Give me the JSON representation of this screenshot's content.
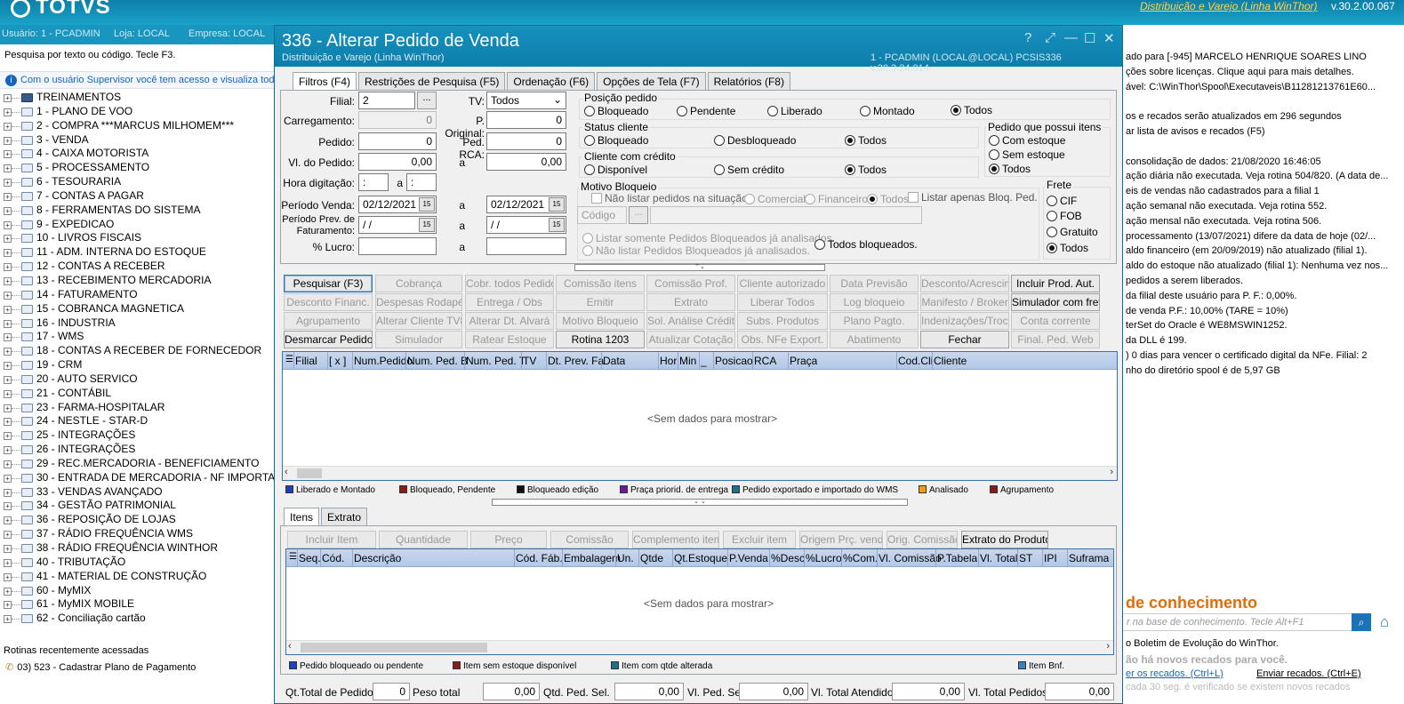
{
  "banner": {
    "logo": "TOTVS",
    "brand_link": "Distribuição e Varejo (Linha WinThor)",
    "version": "v.30.2.00.067"
  },
  "leftbar": {
    "user": "Usuário: 1 - PCADMIN",
    "store": "Loja: LOCAL",
    "company": "Empresa: LOCAL"
  },
  "search_hint": "Pesquisa por texto ou código. Tecle F3.",
  "notice": "Com o usuário Supervisor você tem acesso e visualiza toda",
  "tree": [
    "TREINAMENTOS",
    "1 - PLANO DE VOO",
    "2 - COMPRA          ***MARCUS MILHOMEM***",
    "3 - VENDA",
    "4 - CAIXA MOTORISTA",
    "5 - PROCESSAMENTO",
    "6 - TESOURARIA",
    "7 - CONTAS A PAGAR",
    "8 - FERRAMENTAS DO SISTEMA",
    "9 - EXPEDICAO",
    "10 - LIVROS FISCAIS",
    "11 - ADM. INTERNA DO ESTOQUE",
    "12 - CONTAS A RECEBER",
    "13 - RECEBIMENTO MERCADORIA",
    "14 - FATURAMENTO",
    "15 - COBRANCA MAGNETICA",
    "16 - INDUSTRIA",
    "17 - WMS",
    "18 - CONTAS A RECEBER DE FORNECEDOR",
    "19 - CRM",
    "20 - AUTO SERVICO",
    "21 - CONTÁBIL",
    "23 - FARMA-HOSPITALAR",
    "24 - NESTLE - STAR-D",
    "25 - INTEGRAÇÕES",
    "26 - INTEGRAÇÕES",
    "29 - REC.MERCADORIA - BENEFICIAMENTO",
    "30 - ENTRADA DE MERCADORIA - NF IMPORTAÇÃ",
    "33 - VENDAS AVANÇADO",
    "34 - GESTÃO PATRIMONIAL",
    "36 - REPOSIÇÃO DE LOJAS",
    "37 - RÁDIO FREQUÊNCIA WMS",
    "38 - RÁDIO FREQUÊNCIA WINTHOR",
    "40 - TRIBUTAÇÃO",
    "41 - MATERIAL DE CONSTRUÇÃO",
    "60 - MyMIX",
    "61 - MyMIX MOBILE",
    "62 - Conciliação cartão"
  ],
  "recent": {
    "title": "Rotinas recentemente acessadas",
    "item": "03)  523 - Cadastrar Plano de Pagamento"
  },
  "right_info": [
    "ado para [-945] MARCELO HENRIQUE SOARES LINO",
    "ções sobre licenças. Clique aqui para mais detalhes.",
    "ável: C:\\WinThor\\Spool\\Executaveis\\B11281213761E60...",
    "",
    "os e recados serão atualizados em 296 segundos",
    "ar lista de avisos e recados (F5)",
    "",
    "consolidação de dados: 21/08/2020 16:46:05",
    "ação diária não executada. Veja rotina 504/820. (A data de...",
    "eis de vendas não cadastrados para a filial 1",
    "ação semanal não executada. Veja rotina 552.",
    "ação mensal não executada. Veja rotina 506.",
    "processamento (13/07/2021) difere da data de hoje (02/...",
    "aldo financeiro (em 20/09/2019) não atualizado (filial 1).",
    "aldo do estoque não atualizado (filial 1): Nenhuma vez nos...",
    "pedidos a serem liberados.",
    "da filial deste usuário para P. F.: 0,00%.",
    "de venda P.F.: 10,00% (TARE = 10%)",
    "terSet do Oracle é WE8MSWIN1252.",
    "da DLL é 199.",
    ") 0 dias para vencer o certificado digital da NFe. Filial: 2",
    "nho do diretório spool é de 5,97 GB"
  ],
  "kb": {
    "title": "de conhecimento",
    "search_placeholder": "r na base de conhecimento. Tecle Alt+F1",
    "line1": "o Boletim de Evolução do WinThor.",
    "line2": "ão há novos recados para você.",
    "link1": "er os recados. (Ctrl+L)",
    "link2": "Enviar recados. (Ctrl+E)",
    "line3": "cada 30 seg. é verificado se existem novos recados"
  },
  "dialog": {
    "title": "336 - Alterar Pedido de Venda",
    "subtitle": "Distribuição e Varejo (Linha WinThor)",
    "user_info": "1 - PCADMIN (LOCAL@LOCAL)   PCSIS336  v.30.3.24.014",
    "controls": {
      "help": "?",
      "restore": "⤢",
      "minimize": "—",
      "maximize": "☐",
      "close": "✕"
    },
    "tabs": [
      "Filtros (F4)",
      "Restrições de Pesquisa (F5)",
      "Ordenação (F6)",
      "Opções de Tela (F7)",
      "Relatórios (F8)"
    ],
    "filters": {
      "filial_label": "Filial:",
      "filial_value": "2",
      "lookup": "...",
      "tv_label": "TV:",
      "tv_value": "Todos",
      "carregamento_label": "Carregamento:",
      "carregamento_value": "0",
      "p_original_label": "P. Original:",
      "p_original_value": "0",
      "pedido_label": "Pedido:",
      "pedido_value": "0",
      "ped_rca_label": "Ped. RCA:",
      "ped_rca_value": "0",
      "vl_pedido_label": "Vl. do Pedido:",
      "vl_pedido_from": "0,00",
      "a": "a",
      "vl_pedido_to": "0,00",
      "hora_label": "Hora digitação:",
      "hora_from": ":",
      "hora_to": ":",
      "periodo_label": "Período Venda:",
      "periodo_from": "02/12/2021",
      "periodo_to": "02/12/2021",
      "prev_fat_label1": "Período Prev. de",
      "prev_fat_label2": "Faturamento:",
      "prev_fat_from": " / /",
      "prev_fat_to": " / /",
      "lucro_label": "% Lucro:",
      "calendar": "15"
    },
    "posicao": {
      "title": "Posição pedido",
      "opts": [
        "Bloqueado",
        "Pendente",
        "Liberado",
        "Montado",
        "Todos"
      ]
    },
    "status": {
      "title": "Status cliente",
      "opts": [
        "Bloqueado",
        "Desbloqueado",
        "Todos"
      ]
    },
    "credito": {
      "title": "Cliente com crédito",
      "opts": [
        "Disponível",
        "Sem crédito",
        "Todos"
      ]
    },
    "itens": {
      "title": "Pedido que possui itens",
      "opts": [
        "Com estoque",
        "Sem estoque",
        "Todos"
      ]
    },
    "frete": {
      "title": "Frete",
      "opts": [
        "CIF",
        "FOB",
        "Gratuito",
        "Todos"
      ]
    },
    "motivo": {
      "title": "Motivo Bloqueio",
      "nao_listar": "Não listar pedidos na situação:",
      "opts": [
        "Comercial",
        "Financeiro",
        "Todos"
      ],
      "listar_apenas": "Listar apenas Bloq. Ped.",
      "codigo": "Código",
      "lookup": "...",
      "listar_somente": "Listar somente Pedidos Bloqueados já analisados.",
      "nao_listar_bloq": "Não listar Pedidos Bloqueados já analisados.",
      "todos_bloqueados": "Todos bloqueados."
    },
    "actions": [
      [
        "Pesquisar (F3)",
        "Cobrança",
        "Cobr. todos Pedidos",
        "Comissão itens",
        "Comissão Prof.",
        "Cliente autorizado",
        "Data Previsão",
        "Desconto/Acrescimo",
        "Incluir Prod. Aut."
      ],
      [
        "Desconto Financ.",
        "Despesas Rodapé",
        "Entrega / Obs",
        "Emitir",
        "Extrato",
        "Liberar Todos",
        "Log bloqueio",
        "Manifesto / Broker",
        "Simulador com frete"
      ],
      [
        "Agrupamento",
        "Alterar Cliente TV8",
        "Alterar Dt. Alvará",
        "Motivo Bloqueio",
        "Sol. Análise Crédito",
        "Subs. Produtos",
        "Plano Pagto.",
        "Indenizações/Troca",
        "Conta corrente"
      ],
      [
        "Desmarcar Pedidos",
        "Simulador",
        "Ratear Estoque",
        "Rotina 1203",
        "Atualizar Cotação",
        "Obs. NFe Export.",
        "Abatimento",
        "Fechar",
        "Final. Ped. Web"
      ]
    ],
    "grid1": {
      "columns": [
        "Filial",
        "[ x ]",
        "Num.Pedido",
        "Num. Ped. B",
        "Num. Ped. T",
        "TV",
        "Dt. Prev. Fa",
        "Data",
        "Hor",
        "Min",
        "_",
        "Posicao",
        "RCA",
        "Praça",
        "Cod.Cli",
        "Cliente"
      ],
      "empty": "<Sem dados para mostrar>"
    },
    "legend1": [
      {
        "label": "Liberado e Montado",
        "color": "#1f3fbf"
      },
      {
        "label": "Bloqueado, Pendente",
        "color": "#8b1a1a"
      },
      {
        "label": "Bloqueado edição",
        "color": "#111111"
      },
      {
        "label": "Praça priorid. de entrega",
        "color": "#6a1b9a"
      },
      {
        "label": "Pedido exportado e importado do WMS",
        "color": "#1d6f8a"
      },
      {
        "label": "Analisado",
        "color": "#f39c12"
      },
      {
        "label": "Agrupamento",
        "color": "#8b1a1a"
      }
    ],
    "tabs2": [
      "Itens",
      "Extrato"
    ],
    "item_actions": [
      "Incluir Item",
      "Quantidade",
      "Preço",
      "Comissão",
      "Complemento item",
      "Excluir item",
      "Origem Prç. venda",
      "Orig. Comissão",
      "Extrato do Produto"
    ],
    "grid2": {
      "columns": [
        "Seq.",
        "Cód.",
        "Descrição",
        "Cód. Fáb.",
        "Embalagem",
        "Un.",
        "Qtde",
        "Qt.Estoque",
        "P.Venda",
        "%Desc",
        "%Lucro",
        "%Com.",
        "Vl. Comissão",
        "P.Tabela",
        "Vl. Total",
        "ST",
        "IPI",
        "Suframa"
      ],
      "empty": "<Sem dados para mostrar>"
    },
    "legend2": [
      {
        "label": "Pedido bloqueado ou pendente",
        "color": "#1f3fbf"
      },
      {
        "label": "Item sem estoque disponível",
        "color": "#8b1a1a"
      },
      {
        "label": "Item com qtde alterada",
        "color": "#1d6f8a"
      },
      {
        "label": "Item Bnf.",
        "color": "#3a7fc0"
      }
    ],
    "footer": {
      "qt_total_label": "Qt.Total de Pedidos",
      "qt_total": "0",
      "peso_label": "Peso total",
      "peso": "0,00",
      "qtd_sel_label": "Qtd. Ped. Sel.",
      "qtd_sel": "0,00",
      "vl_sel_label": "Vl. Ped. Sel.",
      "vl_sel": "0,00",
      "vl_atend_label": "Vl. Total Atendido :",
      "vl_atend": "0,00",
      "vl_total_label": "Vl. Total Pedidos :",
      "vl_total": "0,00"
    }
  }
}
